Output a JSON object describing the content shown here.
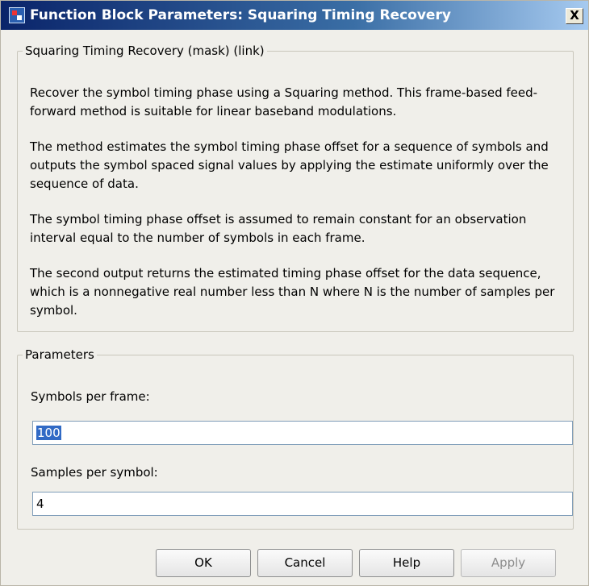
{
  "window": {
    "title": "Function Block Parameters: Squaring Timing Recovery",
    "close_label": "X"
  },
  "description_group": {
    "legend": "Squaring Timing Recovery (mask) (link)",
    "paragraphs": [
      "Recover the symbol timing phase using a Squaring method. This frame-based feed-forward method is suitable for linear baseband modulations.",
      "The method estimates the symbol timing phase offset for a sequence of symbols and outputs the symbol spaced signal values by applying the estimate uniformly over the sequence of data.",
      "The symbol timing phase offset is assumed to remain constant for an observation interval equal to the number of symbols in each frame.",
      "The second output returns the estimated timing phase offset for the data sequence, which is a nonnegative real number less than N where N is the number of samples per symbol."
    ]
  },
  "parameters_group": {
    "legend": "Parameters",
    "symbols_per_frame": {
      "label": "Symbols per frame:",
      "value": "100"
    },
    "samples_per_symbol": {
      "label": "Samples per symbol:",
      "value": "4"
    }
  },
  "buttons": {
    "ok": "OK",
    "cancel": "Cancel",
    "help": "Help",
    "apply": "Apply"
  }
}
